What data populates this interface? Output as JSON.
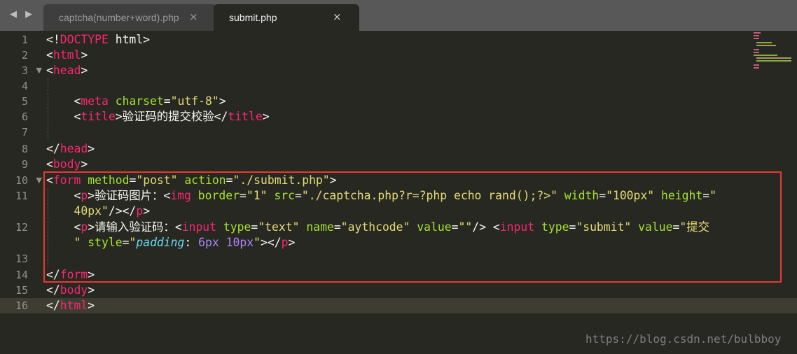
{
  "tabs": [
    {
      "label": "captcha(number+word).php",
      "close": "×",
      "active": false
    },
    {
      "label": "submit.php",
      "close": "×",
      "active": true
    }
  ],
  "nav": {
    "arrows": "◀ ▶"
  },
  "line_numbers": [
    "1",
    "2",
    "3",
    "4",
    "5",
    "6",
    "7",
    "8",
    "9",
    "10",
    "11",
    "",
    "12",
    "",
    "13",
    "14",
    "15",
    "16"
  ],
  "watermark": "https://blog.csdn.net/bulbboy",
  "colors": {
    "tag": "#f92672",
    "attr": "#a6e22e",
    "string": "#e6db74",
    "css": "#66d9ef",
    "number": "#ae81ff",
    "highlight_box": "#e53935"
  }
}
